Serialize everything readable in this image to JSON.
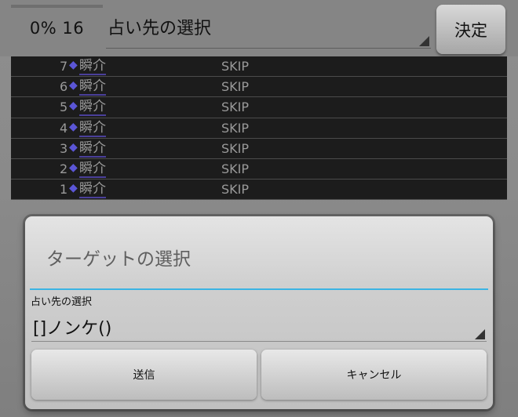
{
  "topbar": {
    "progress_percent": 0,
    "progress_text": "0% 16",
    "fortune_select_value": "占い先の選択",
    "decide_label": "決定"
  },
  "log": {
    "rows": [
      {
        "num": "7",
        "diamond": "◆",
        "name": "瞬介",
        "action": "SKIP"
      },
      {
        "num": "6",
        "diamond": "◆",
        "name": "瞬介",
        "action": "SKIP"
      },
      {
        "num": "5",
        "diamond": "◆",
        "name": "瞬介",
        "action": "SKIP"
      },
      {
        "num": "4",
        "diamond": "◆",
        "name": "瞬介",
        "action": "SKIP"
      },
      {
        "num": "3",
        "diamond": "◆",
        "name": "瞬介",
        "action": "SKIP"
      },
      {
        "num": "2",
        "diamond": "◆",
        "name": "瞬介",
        "action": "SKIP"
      },
      {
        "num": "1",
        "diamond": "◆",
        "name": "瞬介",
        "action": "SKIP"
      }
    ]
  },
  "dialog": {
    "title": "ターゲットの選択",
    "label": "占い先の選択",
    "select_value": "[]ノンケ()",
    "send_label": "送信",
    "cancel_label": "キャンセル"
  },
  "icons": {
    "dropdown": "dropdown-triangle-icon",
    "player_marker": "diamond-icon"
  },
  "colors": {
    "accent": "#3bb4e3",
    "diamond": "#5b56d6",
    "row_background": "#1c1c1c"
  }
}
